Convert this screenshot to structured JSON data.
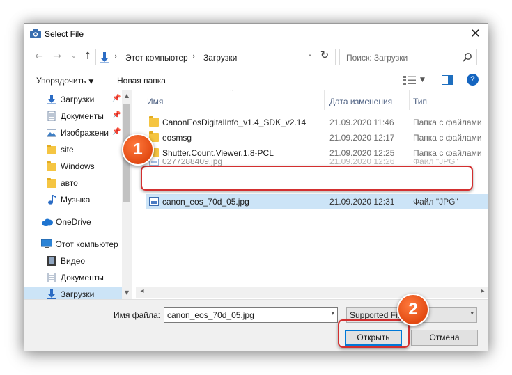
{
  "window": {
    "title": "Select File",
    "close_glyph": "✕"
  },
  "nav": {
    "back_glyph": "←",
    "forward_glyph": "→",
    "recent_glyph": "⌄",
    "up_glyph": "↑",
    "breadcrumb": [
      "Этот компьютер",
      "Загрузки"
    ],
    "crumb_sep": "›",
    "refresh_glyph": "↻",
    "search_placeholder": "Поиск: Загрузки",
    "search_icon": "search-icon"
  },
  "toolbar": {
    "organize_label": "Упорядочить",
    "new_folder_label": "Новая папка",
    "caret": "▼"
  },
  "sidebar": {
    "items": [
      {
        "label": "Загрузки",
        "icon": "download-arrow-icon",
        "pinned": true
      },
      {
        "label": "Документы",
        "icon": "documents-icon",
        "pinned": true
      },
      {
        "label": "Изображени",
        "icon": "pictures-icon",
        "pinned": true
      },
      {
        "label": "site",
        "icon": "folder-icon"
      },
      {
        "label": "Windows",
        "icon": "folder-icon"
      },
      {
        "label": "авто",
        "icon": "folder-icon"
      },
      {
        "label": "Музыка",
        "icon": "music-icon"
      },
      {
        "label": "OneDrive",
        "icon": "cloud-icon"
      },
      {
        "label": "Этот компьютер",
        "icon": "computer-icon"
      },
      {
        "label": "Видео",
        "icon": "video-icon"
      },
      {
        "label": "Документы",
        "icon": "documents-icon"
      },
      {
        "label": "Загрузки",
        "icon": "download-arrow-icon",
        "selected": true
      }
    ],
    "pin_glyph": "✈"
  },
  "columns": {
    "name": "Имя",
    "date": "Дата изменения",
    "type": "Тип"
  },
  "files": [
    {
      "name": "CanonEosDigitalInfo_v1.4_SDK_v2.14",
      "date": "21.09.2020 11:46",
      "type": "Папка с файлами",
      "kind": "folder"
    },
    {
      "name": "eosmsg",
      "date": "21.09.2020 12:17",
      "type": "Папка с файлами",
      "kind": "folder"
    },
    {
      "name": "Shutter.Count.Viewer.1.8-PCL",
      "date": "21.09.2020 12:25",
      "type": "Папка с файлами",
      "kind": "folder"
    },
    {
      "name": "0277288409.jpg",
      "date": "21.09.2020 12:26",
      "type": "Файл \"JPG\"",
      "kind": "jpg",
      "partial": true
    },
    {
      "name": "canon_eos_70d_05.jpg",
      "date": "21.09.2020 12:31",
      "type": "Файл \"JPG\"",
      "kind": "jpg",
      "selected": true
    }
  ],
  "bottom": {
    "filename_label": "Имя файла:",
    "filename_value": "canon_eos_70d_05.jpg",
    "filter_value": "Supported Files",
    "open_label": "Открыть",
    "cancel_label": "Отмена"
  },
  "annotations": {
    "badge1": "1",
    "badge2": "2",
    "highlight_color": "#d32f2f",
    "badge_color": "#e24a12"
  }
}
